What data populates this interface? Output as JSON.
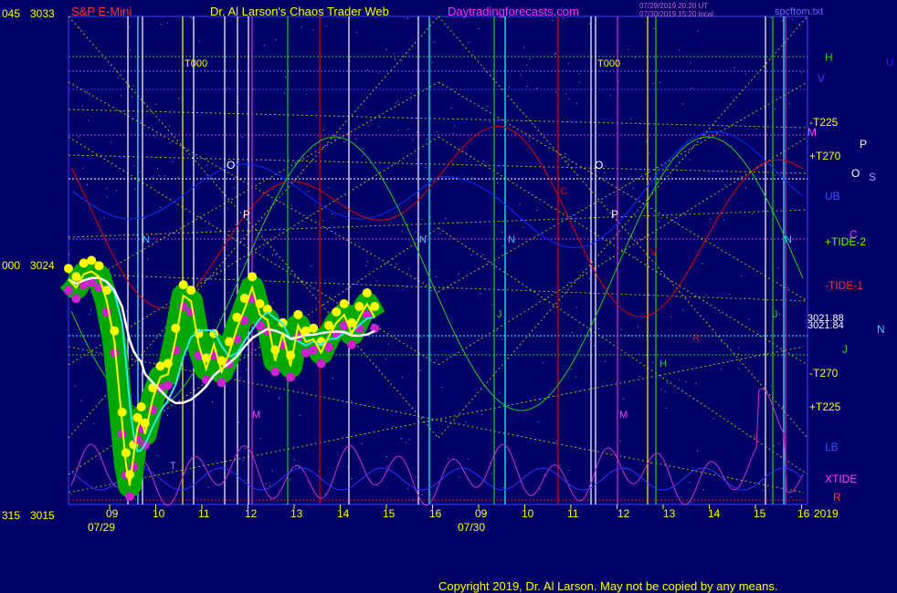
{
  "header": {
    "symbol": "S&P E-Mini",
    "author": "Dr. Al Larson's Chaos Trader Web",
    "site": "Daytradingforecasts.com",
    "stamp1": "07/29/2019 20:20 UT",
    "stamp2": "07/30/2019 15:20 local",
    "file": "spcftom.txt"
  },
  "footer": {
    "copyright": "Copyright 2019, Dr. Al Larson. May not be copied by any means."
  },
  "colors": {
    "background": "#000066",
    "price_line": "#ffff00",
    "band": "#00a800",
    "moving_avg_cyan": "#33e6e6",
    "moving_avg_white": "#ffffff",
    "red_curve": "#dd0000",
    "green_curve": "#22cc22",
    "blue_curve": "#0033ff",
    "magenta_curve": "#cc33cc",
    "grid_dotted": "#d9d900"
  },
  "chart_data": {
    "type": "line",
    "title": "S&P E-Mini",
    "y_axis": {
      "ticks": [
        {
          "value": 3033,
          "left_label": "045",
          "right_label": "3033"
        },
        {
          "value": 3024,
          "left_label": "000",
          "right_label": "3024"
        },
        {
          "value": 3015,
          "left_label": "315",
          "right_label": "3015"
        }
      ],
      "ylim": [
        3015,
        3033
      ]
    },
    "x_axis": {
      "time_ticks": [
        "09",
        "10",
        "11",
        "12",
        "13",
        "14",
        "15",
        "16",
        "09",
        "10",
        "11",
        "12",
        "13",
        "14",
        "15",
        "16"
      ],
      "dates": [
        "07/29",
        "07/30"
      ],
      "year": "2019"
    },
    "value_readout": [
      "3021.88",
      "3021.84"
    ],
    "right_labels": [
      {
        "text": "H",
        "color": "#22cc22"
      },
      {
        "text": "U",
        "color": "#2222ff"
      },
      {
        "text": "V",
        "color": "#3344ff"
      },
      {
        "text": "-T225",
        "color": "#ffff00"
      },
      {
        "text": "M",
        "color": "#ff44ff"
      },
      {
        "text": "P",
        "color": "#ffffff"
      },
      {
        "text": "+T270",
        "color": "#ffff00"
      },
      {
        "text": "O",
        "color": "#ffffff"
      },
      {
        "text": "S",
        "color": "#9999ff"
      },
      {
        "text": "UB",
        "color": "#3355ff"
      },
      {
        "text": "C",
        "color": "#ff33ff"
      },
      {
        "text": "+TIDE-2",
        "color": "#66ff00"
      },
      {
        "text": "-TIDE-1",
        "color": "#ff3333"
      },
      {
        "text": "N",
        "color": "#33ccff"
      },
      {
        "text": "J",
        "color": "#33cc33"
      },
      {
        "text": "-T270",
        "color": "#ffff00"
      },
      {
        "text": "+T225",
        "color": "#ffff00"
      },
      {
        "text": "LB",
        "color": "#3355ff"
      },
      {
        "text": "XTIDE",
        "color": "#ff44ff"
      },
      {
        "text": "R",
        "color": "#ff3333"
      }
    ],
    "plot_labels": [
      "T000",
      "T000",
      "O",
      "P",
      "O",
      "P",
      "N",
      "N",
      "N",
      "N",
      "C",
      "M",
      "M",
      "J",
      "J",
      "H",
      "R",
      "V",
      "T"
    ],
    "series": [
      {
        "name": "",
        "type": "price_close",
        "t": [
          0,
          10,
          20,
          30,
          40,
          50,
          60,
          70,
          75,
          80,
          85,
          90,
          95,
          100,
          110,
          120,
          130,
          140,
          150,
          160,
          170,
          180,
          190,
          200,
          210,
          220,
          230,
          240,
          250,
          260,
          270,
          280,
          290,
          300,
          310,
          320,
          330,
          340,
          350,
          360,
          370,
          380,
          390,
          400
        ],
        "values": [
          3023.3,
          3023.0,
          3023.5,
          3023.6,
          3023.4,
          3022.5,
          3021.0,
          3018.0,
          3016.5,
          3015.7,
          3016.8,
          3017.8,
          3018.2,
          3017.6,
          3018.9,
          3019.7,
          3019.8,
          3021.1,
          3022.7,
          3022.5,
          3020.9,
          3020.0,
          3020.9,
          3019.9,
          3020.6,
          3021.5,
          3022.2,
          3023.0,
          3022.0,
          3021.8,
          3020.3,
          3021.3,
          3020.1,
          3021.6,
          3021.0,
          3021.1,
          3020.6,
          3021.2,
          3021.7,
          3022.0,
          3021.3,
          3021.9,
          3022.4,
          3021.9
        ]
      }
    ],
    "session_end_t": 400,
    "t_units": "minutes from 07/29 08:30"
  }
}
